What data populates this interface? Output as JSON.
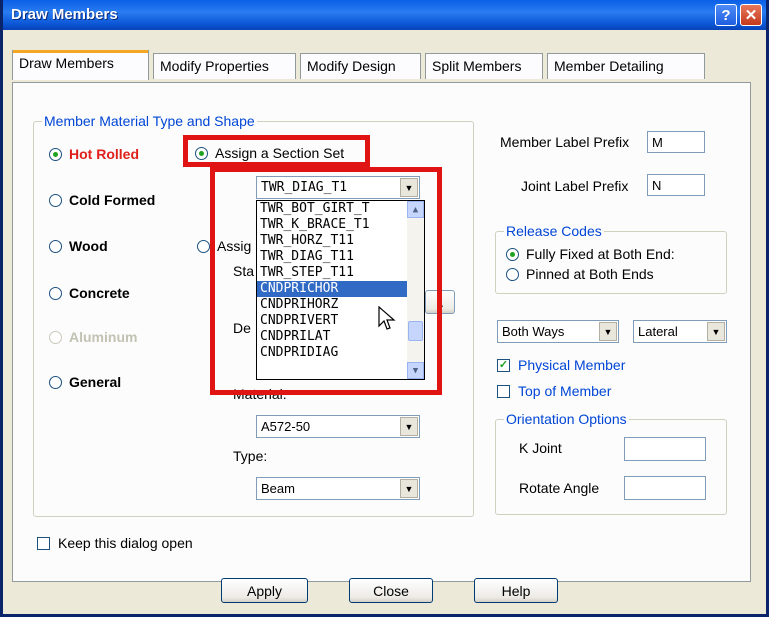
{
  "window": {
    "title": "Draw Members",
    "help_glyph": "?",
    "close_glyph": "✕"
  },
  "tabs": [
    {
      "label": "Draw Members"
    },
    {
      "label": "Modify Properties"
    },
    {
      "label": "Modify Design"
    },
    {
      "label": "Split Members"
    },
    {
      "label": "Member Detailing"
    }
  ],
  "material": {
    "group_title": "Member Material Type and Shape",
    "types": [
      {
        "label": "Hot Rolled",
        "selected": true,
        "enabled": true
      },
      {
        "label": "Cold Formed",
        "selected": false,
        "enabled": true
      },
      {
        "label": "Wood",
        "selected": false,
        "enabled": true
      },
      {
        "label": "Concrete",
        "selected": false,
        "enabled": true
      },
      {
        "label": "Aluminum",
        "selected": false,
        "enabled": false
      },
      {
        "label": "General",
        "selected": false,
        "enabled": true
      }
    ],
    "assign_section_set": "Assign a Section Set",
    "assign_partial": "Assig",
    "sta_partial": "Sta",
    "de_partial": "De",
    "section_set_value": "TWR_DIAG_T1",
    "section_set_options": [
      "TWR_BOT_GIRT_T",
      "TWR_K_BRACE_T1",
      "TWR_HORZ_T11",
      "TWR_DIAG_T11",
      "TWR_STEP_T11",
      "CNDPRICHOR",
      "CNDPRIHORZ",
      "CNDPRIVERT",
      "CNDPRILAT",
      "CNDPRIDIAG"
    ],
    "selected_option": "CNDPRICHOR",
    "material_label": "Material:",
    "material_value": "A572-50",
    "type_label": "Type:",
    "type_value": "Beam",
    "ellipsis": ".."
  },
  "labels": {
    "member_prefix_label": "Member Label Prefix",
    "member_prefix_value": "M",
    "joint_prefix_label": "Joint Label Prefix",
    "joint_prefix_value": "N"
  },
  "release": {
    "group_title": "Release Codes",
    "options": [
      {
        "label": "Fully Fixed at Both End:",
        "selected": true
      },
      {
        "label": "Pinned at Both Ends",
        "selected": false
      }
    ]
  },
  "direction": {
    "value": "Both Ways",
    "axis_value": "Lateral"
  },
  "checks": {
    "physical_member": {
      "label": "Physical Member",
      "checked": true
    },
    "top_of_member": {
      "label": "Top of Member",
      "checked": false
    },
    "keep_open": {
      "label": "Keep this dialog open",
      "checked": false
    }
  },
  "orientation": {
    "group_title": "Orientation Options",
    "k_joint_label": "K Joint",
    "k_joint_value": "",
    "rotate_label": "Rotate Angle",
    "rotate_value": ""
  },
  "buttons": {
    "apply": "Apply",
    "close": "Close",
    "help": "Help"
  },
  "colors": {
    "highlight_frame": "#e11414",
    "selection": "#316ac5",
    "accent_text": "#e0201b"
  }
}
